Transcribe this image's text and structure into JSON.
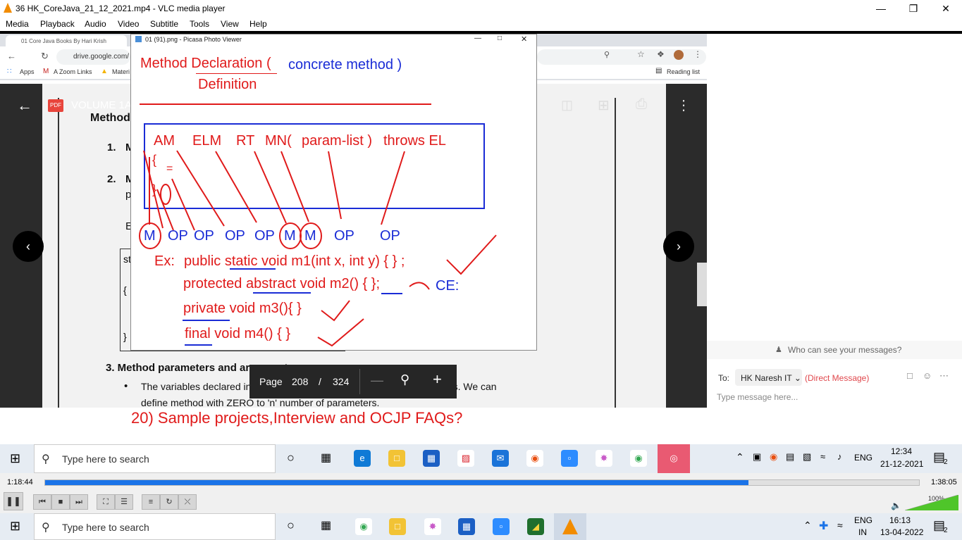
{
  "app": {
    "title": "36 HK_CoreJava_21_12_2021.mp4 - VLC media player"
  },
  "menu": [
    "Media",
    "Playback",
    "Audio",
    "Video",
    "Subtitle",
    "Tools",
    "View",
    "Help"
  ],
  "chrome": {
    "tab_label": "01 Core Java Books By Hari Krish",
    "url": "drive.google.com/",
    "bookmarks": [
      "Apps",
      "A Zoom Links",
      "Materi"
    ],
    "reading_list": "Reading list"
  },
  "pdf": {
    "file_badge": "PDF",
    "file_title": "VOLUME 1A",
    "page_label": "Page",
    "page_current": "208",
    "page_sep": "/",
    "page_total": "324",
    "doc_heading": "Method",
    "doc_items": [
      "1.",
      "2.",
      "3."
    ],
    "doc_partial": [
      "M",
      "M",
      "p",
      "E",
      "st",
      "{",
      "}"
    ],
    "section3_title": "3.  Method parameters and arguments:",
    "bullet_text": "The variables declared in method parenthesis \"( )\" are called parameters. We can",
    "bullet_text2": "define method with ZERO to 'n' number of parameters.",
    "banner": "20)  Sample projects,Interview and OCJP FAQs?"
  },
  "picasa": {
    "title": "01 (91).png - Picasa Photo Viewer",
    "heading1": "Method Declaration (",
    "heading1b": "concrete method )",
    "heading2": "Definition",
    "syntax_parts": [
      "AM",
      "ELM",
      "RT",
      "MN(",
      "param-list )",
      "throws EL"
    ],
    "brace_open": "{",
    "brace_dots": "=",
    "brace_close": "}",
    "labels": [
      "M",
      "OP",
      "OP",
      "OP",
      "OP",
      "M",
      "M",
      "OP",
      "OP"
    ],
    "ex_label": "Ex:",
    "ex1": "public static void m1(int x, int y) {   } ;",
    "ex2": "protected abstract void m2() {  };",
    "ex2_ce": "CE:",
    "ex3": "private void m3(){ }",
    "ex4": "final void m4() { }"
  },
  "zoom": {
    "who": "Who can see your messages?",
    "to_label": "To:",
    "to_value": "HK Naresh IT",
    "direct": "(Direct Message)",
    "placeholder": "Type message here..."
  },
  "inner_taskbar": {
    "search": "Type here to search",
    "lang": "ENG",
    "time": "12:34",
    "date": "21-12-2021",
    "notif": "2"
  },
  "vlc": {
    "elapsed": "1:18:44",
    "total": "1:38:05",
    "progress": 0.805,
    "volume_label": "100%",
    "volume": 1.0
  },
  "outer_taskbar": {
    "search": "Type here to search",
    "lang": "ENG",
    "region": "IN",
    "time": "16:13",
    "date": "13-04-2022",
    "notif": "2"
  },
  "colors": {
    "ink_red": "#e01a1a",
    "ink_blue": "#1a2cd6",
    "vlc_orange": "#f28c00",
    "seek_blue": "#1a73e8"
  }
}
